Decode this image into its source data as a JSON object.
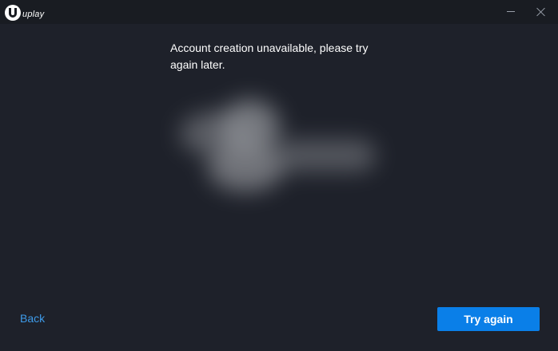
{
  "titlebar": {
    "logo_text": "uplay",
    "minimize_icon": "minimize-icon",
    "close_icon": "close-icon"
  },
  "main": {
    "message": "Account creation unavailable, please try again later.",
    "illustration": "blurred-illustration"
  },
  "footer": {
    "back_label": "Back",
    "try_again_label": "Try again"
  },
  "colors": {
    "background": "#1e212a",
    "titlebar": "#191c22",
    "accent": "#0a7fe8",
    "link": "#3e9be9"
  }
}
